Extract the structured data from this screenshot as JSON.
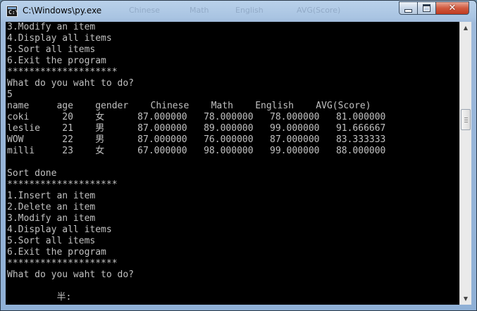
{
  "window": {
    "title": "C:\\Windows\\py.exe",
    "background_ghost": [
      "Chinese",
      "Math",
      "English",
      "AVG(Score)"
    ],
    "close_label": "✕"
  },
  "console": {
    "lines": [
      "3.Modify an item",
      "4.Display all items",
      "5.Sort all items",
      "6.Exit the program",
      "********************",
      "What do you waht to do?",
      "5",
      "name     age    gender    Chinese    Math    English    AVG(Score)",
      "coki      20    女      87.000000   78.000000   78.000000   81.000000",
      "leslie    21    男      87.000000   89.000000   99.000000   91.666667",
      "WOW       22    男      87.000000   76.000000   87.000000   83.333333",
      "milli     23    女      67.000000   98.000000   99.000000   88.000000",
      "",
      "Sort done",
      "********************",
      "1.Insert an item",
      "2.Delete an item",
      "3.Modify an item",
      "4.Display all items",
      "5.Sort all items",
      "6.Exit the program",
      "********************",
      "What do you waht to do?",
      "",
      "         半:"
    ]
  },
  "icons": [
    "console-app-icon",
    "minimize-icon",
    "maximize-icon",
    "close-icon",
    "scroll-up-arrow-icon",
    "scroll-down-arrow-icon"
  ],
  "colors": {
    "console_bg": "#000000",
    "console_text": "#c0c0c0",
    "titlebar": "#b9d1ea",
    "close_button": "#c8452b"
  }
}
